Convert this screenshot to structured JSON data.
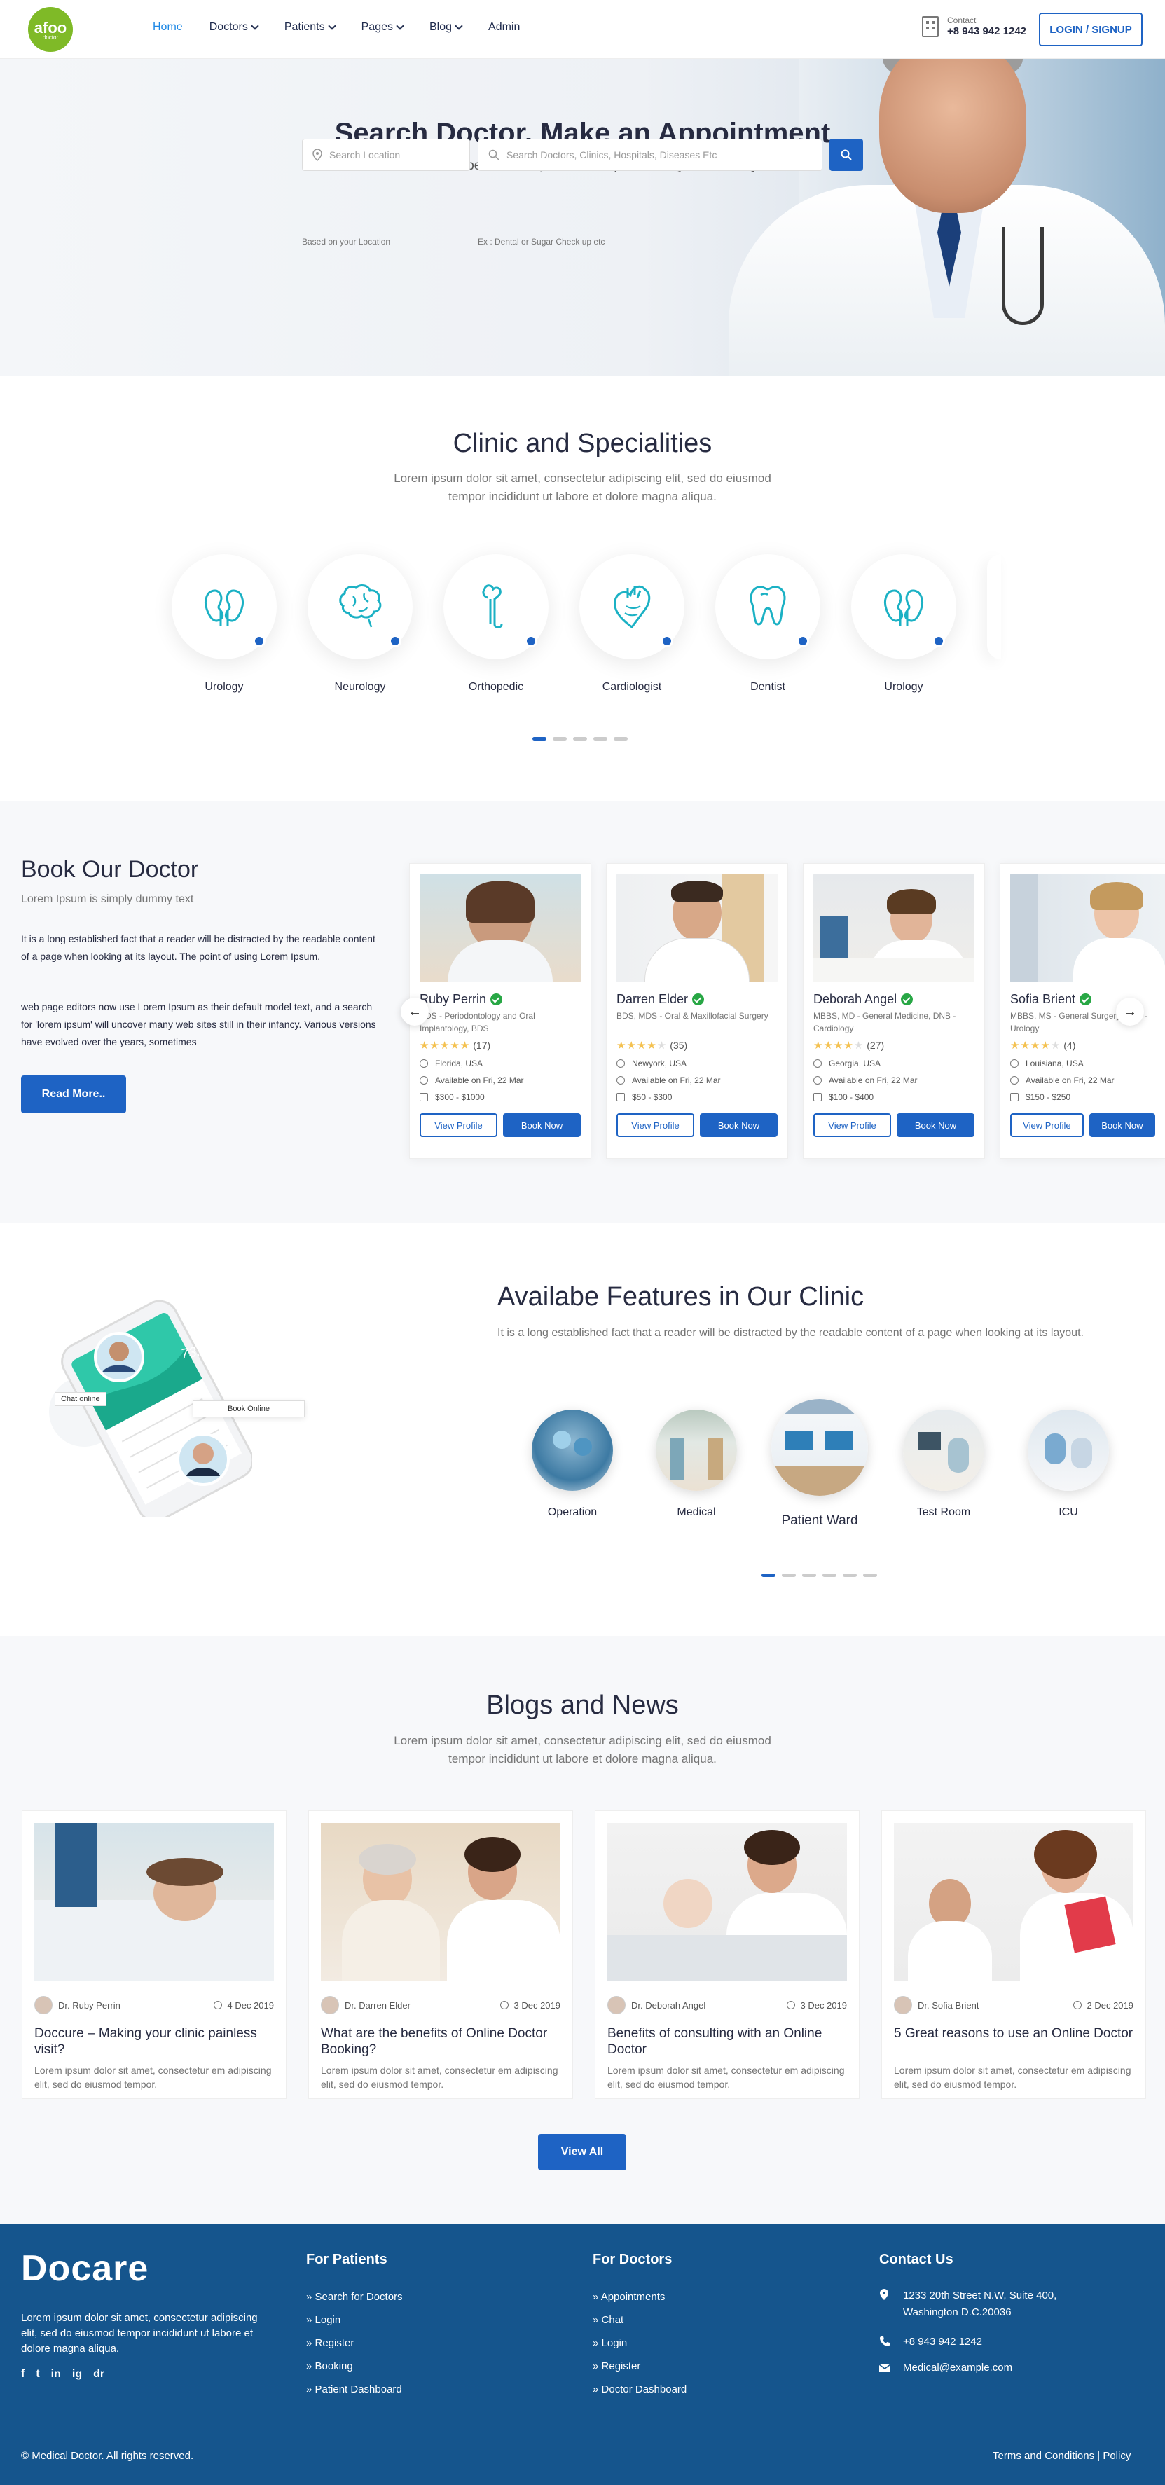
{
  "header": {
    "logo_text": "afoo",
    "logo_sub": "doctor",
    "nav": [
      {
        "label": "Home",
        "dropdown": false
      },
      {
        "label": "Doctors",
        "dropdown": true
      },
      {
        "label": "Patients",
        "dropdown": true
      },
      {
        "label": "Pages",
        "dropdown": true
      },
      {
        "label": "Blog",
        "dropdown": true
      },
      {
        "label": "Admin",
        "dropdown": false
      }
    ],
    "contact_label": "Contact",
    "contact_phone": "+8 943 942 1242",
    "login_label": "LOGIN / SIGNUP"
  },
  "hero": {
    "title": "Search Doctor, Make an Appointment",
    "subtitle": "Discover the best doctors, clinic & hospital the city nearest to you.",
    "location_placeholder": "Search Location",
    "location_hint": "Based on your Location",
    "search_placeholder": "Search Doctors, Clinics, Hospitals, Diseases Etc",
    "search_hint": "Ex : Dental or Sugar Check up etc"
  },
  "specialities": {
    "title": "Clinic and Specialities",
    "subtitle_line1": "Lorem ipsum dolor sit amet, consectetur adipiscing elit, sed do eiusmod",
    "subtitle_line2": "tempor incididunt ut labore et dolore magna aliqua.",
    "items": [
      {
        "label": "Urology",
        "icon": "kidney-icon"
      },
      {
        "label": "Neurology",
        "icon": "brain-icon"
      },
      {
        "label": "Orthopedic",
        "icon": "bone-icon"
      },
      {
        "label": "Cardiologist",
        "icon": "heart-icon"
      },
      {
        "label": "Dentist",
        "icon": "tooth-icon"
      },
      {
        "label": "Urology",
        "icon": "kidney-icon"
      }
    ]
  },
  "book": {
    "title": "Book Our Doctor",
    "subtitle": "Lorem Ipsum is simply dummy text",
    "para1": "It is a long established fact that a reader will be distracted by the readable content of a page when looking at its layout. The point of using Lorem Ipsum.",
    "para2": "web page editors now use Lorem Ipsum as their default model text, and a search for 'lorem ipsum' will uncover many web sites still in their infancy. Various versions have evolved over the years, sometimes",
    "read_more": "Read More..",
    "view_profile": "View Profile",
    "book_now": "Book Now",
    "doctors": [
      {
        "name": "Ruby Perrin",
        "degree": "BDS - Periodontology and Oral Implantology, BDS",
        "rating": 5,
        "reviews": "(17)",
        "location": "Florida, USA",
        "available": "Available on Fri, 22 Mar",
        "price": "$300 - $1000"
      },
      {
        "name": "Darren Elder",
        "degree": "BDS, MDS - Oral & Maxillofacial Surgery",
        "rating": 4,
        "reviews": "(35)",
        "location": "Newyork, USA",
        "available": "Available on Fri, 22 Mar",
        "price": "$50 - $300"
      },
      {
        "name": "Deborah Angel",
        "degree": "MBBS, MD - General Medicine, DNB - Cardiology",
        "rating": 4,
        "reviews": "(27)",
        "location": "Georgia, USA",
        "available": "Available on Fri, 22 Mar",
        "price": "$100 - $400"
      },
      {
        "name": "Sofia Brient",
        "degree": "MBBS, MS - General Surgery, MCh - Urology",
        "rating": 4,
        "reviews": "(4)",
        "location": "Louisiana, USA",
        "available": "Available on Fri, 22 Mar",
        "price": "$150 - $250"
      }
    ]
  },
  "features": {
    "title": "Availabe Features in Our Clinic",
    "text": "It is a long established fact that a reader will be distracted by the readable content of a page when looking at its layout.",
    "phone_weight": "73.5 kg",
    "chat_online": "Chat online",
    "book_online": "Book Online",
    "items": [
      "Operation",
      "Medical",
      "Patient Ward",
      "Test Room",
      "ICU"
    ]
  },
  "blogs": {
    "title": "Blogs and News",
    "subtitle_line1": "Lorem ipsum dolor sit amet, consectetur adipiscing elit, sed do eiusmod",
    "subtitle_line2": "tempor incididunt ut labore et dolore magna aliqua.",
    "view_all": "View All",
    "posts": [
      {
        "author": "Dr. Ruby Perrin",
        "date": "4 Dec 2019",
        "title": "Doccure – Making your clinic painless visit?",
        "text": "Lorem ipsum dolor sit amet, consectetur em adipiscing elit, sed do eiusmod tempor."
      },
      {
        "author": "Dr. Darren Elder",
        "date": "3 Dec 2019",
        "title": "What are the benefits of Online Doctor Booking?",
        "text": "Lorem ipsum dolor sit amet, consectetur em adipiscing elit, sed do eiusmod tempor."
      },
      {
        "author": "Dr. Deborah Angel",
        "date": "3 Dec 2019",
        "title": "Benefits of consulting with an Online Doctor",
        "text": "Lorem ipsum dolor sit amet, consectetur em adipiscing elit, sed do eiusmod tempor."
      },
      {
        "author": "Dr. Sofia Brient",
        "date": "2 Dec 2019",
        "title": "5 Great reasons to use an Online Doctor",
        "text": "Lorem ipsum dolor sit amet, consectetur em adipiscing elit, sed do eiusmod tempor."
      }
    ]
  },
  "footer": {
    "logo": "Docare",
    "desc": "Lorem ipsum dolor sit amet, consectetur adipiscing elit, sed do eiusmod tempor incididunt ut labore et dolore magna aliqua.",
    "social": [
      "f",
      "t",
      "in",
      "ig",
      "dr"
    ],
    "patients_title": "For Patients",
    "patients_links": [
      "Search for Doctors",
      "Login",
      "Register",
      "Booking",
      "Patient Dashboard"
    ],
    "doctors_title": "For Doctors",
    "doctors_links": [
      "Appointments",
      "Chat",
      "Login",
      "Register",
      "Doctor Dashboard"
    ],
    "contact_title": "Contact Us",
    "address_line1": "1233 20th Street N.W, Suite 400,",
    "address_line2": "Washington D.C.20036",
    "phone": "+8 943 942 1242",
    "email": "Medical@example.com",
    "copyright": "© Medical Doctor. All rights reserved.",
    "terms": "Terms and Conditions",
    "policy": "Policy"
  },
  "colors": {
    "primary": "#1e63c4",
    "footer": "#15558d",
    "logo": "#7fba27",
    "star": "#f4c150",
    "verified": "#28a745"
  }
}
